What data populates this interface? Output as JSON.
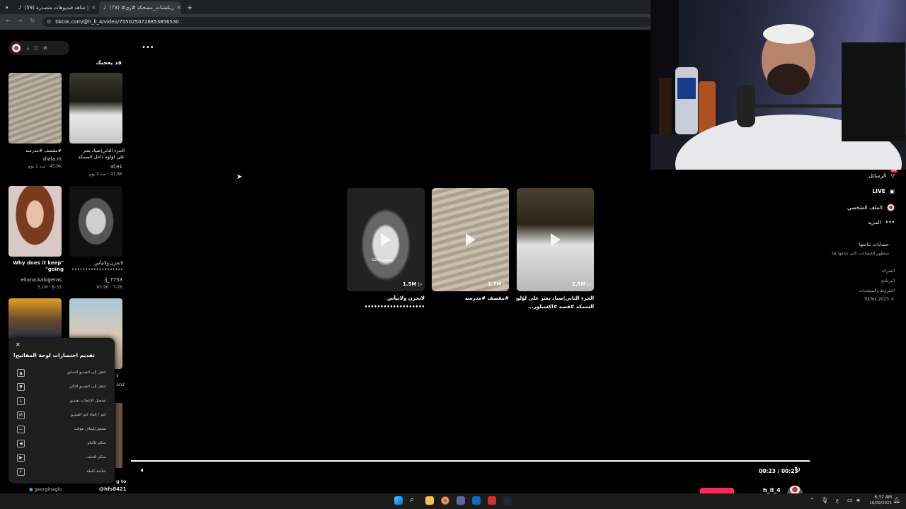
{
  "browser": {
    "tabs": [
      {
        "label": "(59) شاهد فيديوهات متصدرة |"
      },
      {
        "label": "(73) #ريكشنات_مضحكة #ري"
      }
    ],
    "url": "tiktok.com/@h_ll_4/video/7550250726853856530"
  },
  "sidebar": {
    "section_title": "قد يعجبك",
    "items": [
      {
        "caption": "#مقصف #مدرسه",
        "author": "diala.m",
        "stats": "45.9K · منذ 2 يوم"
      },
      {
        "caption": "الجزء الثاني|صياد يعثر على لؤلؤه داخل السمكه #قصه...",
        "author": "af.e1",
        "stats": "47.8K · منذ 2 يوم"
      },
      {
        "caption": "\"Why does it keep going\"",
        "author": "eliana.kalogeras",
        "stats": "5.1M · 8-31"
      },
      {
        "caption": "لاتحزن ولاتيأس ••••••••••••••••••••",
        "author": "lj_7753",
        "stats": "93.9K · 7-26"
      }
    ],
    "bottom_authors": {
      "left": "georginagio",
      "right": "@hfs8421"
    },
    "edge_texts": [
      "لا ا",
      "an2",
      "g to",
      "..."
    ]
  },
  "popup": {
    "title": "تقديم اختصارات لوحة المفاتيح!",
    "rows": [
      {
        "key": "▲",
        "label": "انتقل إلى الفيديو السابق"
      },
      {
        "key": "▼",
        "label": "انتقل إلى الفيديو التالي"
      },
      {
        "key": "L",
        "label": "تسجيل الإعجاب بفيديو"
      },
      {
        "key": "M",
        "label": "كتم / إلغاء كتم الفيديو"
      },
      {
        "key": "⌴",
        "label": "تشغيل/إيقاف مؤقت"
      },
      {
        "key": "◀",
        "label": "تحكم للأمام"
      },
      {
        "key": "▶",
        "label": "تحكم للخلف"
      },
      {
        "key": "F",
        "label": "شاشة كاملة"
      }
    ]
  },
  "grid": {
    "cards": [
      {
        "views": "1.5M",
        "caption": "لاتحزن ولاتيأس",
        "caption2": "♦♦♦♦♦♦♦♦♦♦♦♦♦♦♦♦♦♦♦",
        "overlay": "core يوسف"
      },
      {
        "views": "1.7M",
        "caption": "#مقصف #مدرسه",
        "caption2": ""
      },
      {
        "views": "2.5M",
        "caption": "الجزء الثاني|صياد يعثر على لؤلوه داخل",
        "caption2": "السمكه #قصه #اكسبلور..."
      }
    ]
  },
  "right_nav": {
    "messages": "الرسائل",
    "messages_badge": "59",
    "live": "LIVE",
    "profile": "الملف الشخصي",
    "more": "المزيد",
    "following_title": "حسابات تتابعها",
    "following_sub": "ستظهر الحسابات التي تتابعها هنا",
    "links": [
      "الشركة",
      "البرنامج",
      "الشروط والسياسات",
      "© 2025 TikTok"
    ]
  },
  "player": {
    "time": "00:23 / 00:23",
    "username": "h_ll_4"
  },
  "taskbar": {
    "time": "6:37 AM",
    "date": "16/09/2025",
    "lang": "ع"
  },
  "colors": {
    "accent": "#fe2c55",
    "bg": "#000000",
    "panel": "#1e1e1e"
  }
}
